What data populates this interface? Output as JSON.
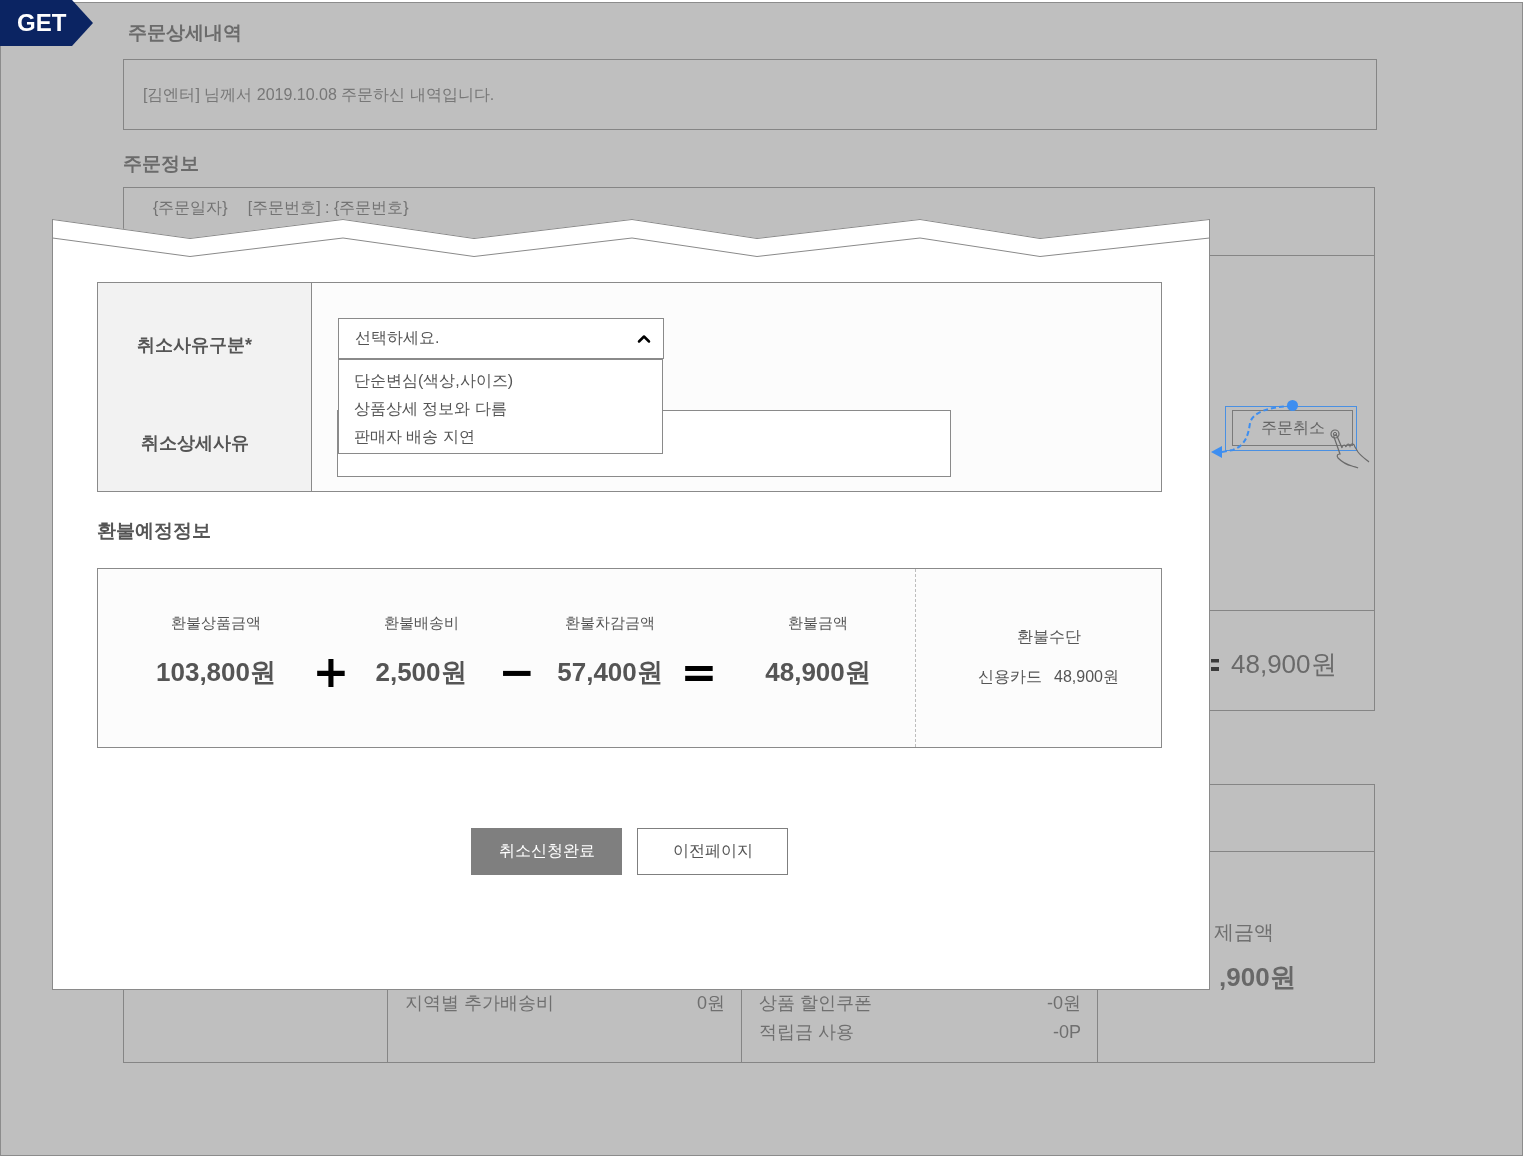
{
  "badge": "GET",
  "page": {
    "title": "주문상세내역",
    "notice": "[김엔터] 님께서 2019.10.08 주문하신 내역입니다.",
    "order_info": {
      "heading": "주문정보",
      "order_date": "{주문일자}",
      "order_number": "[주문번호] : {주문번호}",
      "cancel_button": "주문취소",
      "total": "48,900원"
    },
    "payment": {
      "fees": [
        {
          "label": "지역별 추가배송비",
          "value": "0원"
        }
      ],
      "discounts": [
        {
          "label": "상품 할인쿠폰",
          "value": "-0원"
        },
        {
          "label": "적립금 사용",
          "value": "-0P"
        }
      ],
      "paid_label": "제금액",
      "paid_amount": ",900원"
    }
  },
  "modal": {
    "form": {
      "reason_label": "취소사유구분*",
      "reason_select": {
        "value": "선택하세요.",
        "expanded": true,
        "options": [
          {
            "label": "단순변심(색상,사이즈)",
            "selected": false
          },
          {
            "label": "상품상세 정보와 다름",
            "selected": false
          },
          {
            "label": "판매자 배송 지연",
            "selected": false
          }
        ]
      },
      "detail_label": "취소상세사유"
    },
    "refund": {
      "heading": "환불예정정보",
      "terms": [
        {
          "kind": "amount",
          "label": "환불상품금액",
          "value": "103,800원"
        },
        {
          "kind": "operator",
          "symbol": "+"
        },
        {
          "kind": "amount",
          "label": "환불배송비",
          "value": "2,500원"
        },
        {
          "kind": "operator",
          "symbol": "−"
        },
        {
          "kind": "amount",
          "label": "환불차감금액",
          "value": "57,400원"
        },
        {
          "kind": "operator",
          "symbol": "="
        },
        {
          "kind": "amount",
          "label": "환불금액",
          "value": "48,900원"
        }
      ],
      "method_label": "환불수단",
      "method": "신용카드",
      "method_amount": "48,900원"
    },
    "buttons": [
      {
        "kind": "primary",
        "label": "취소신청완료"
      },
      {
        "kind": "secondary",
        "label": "이전페이지"
      }
    ]
  }
}
